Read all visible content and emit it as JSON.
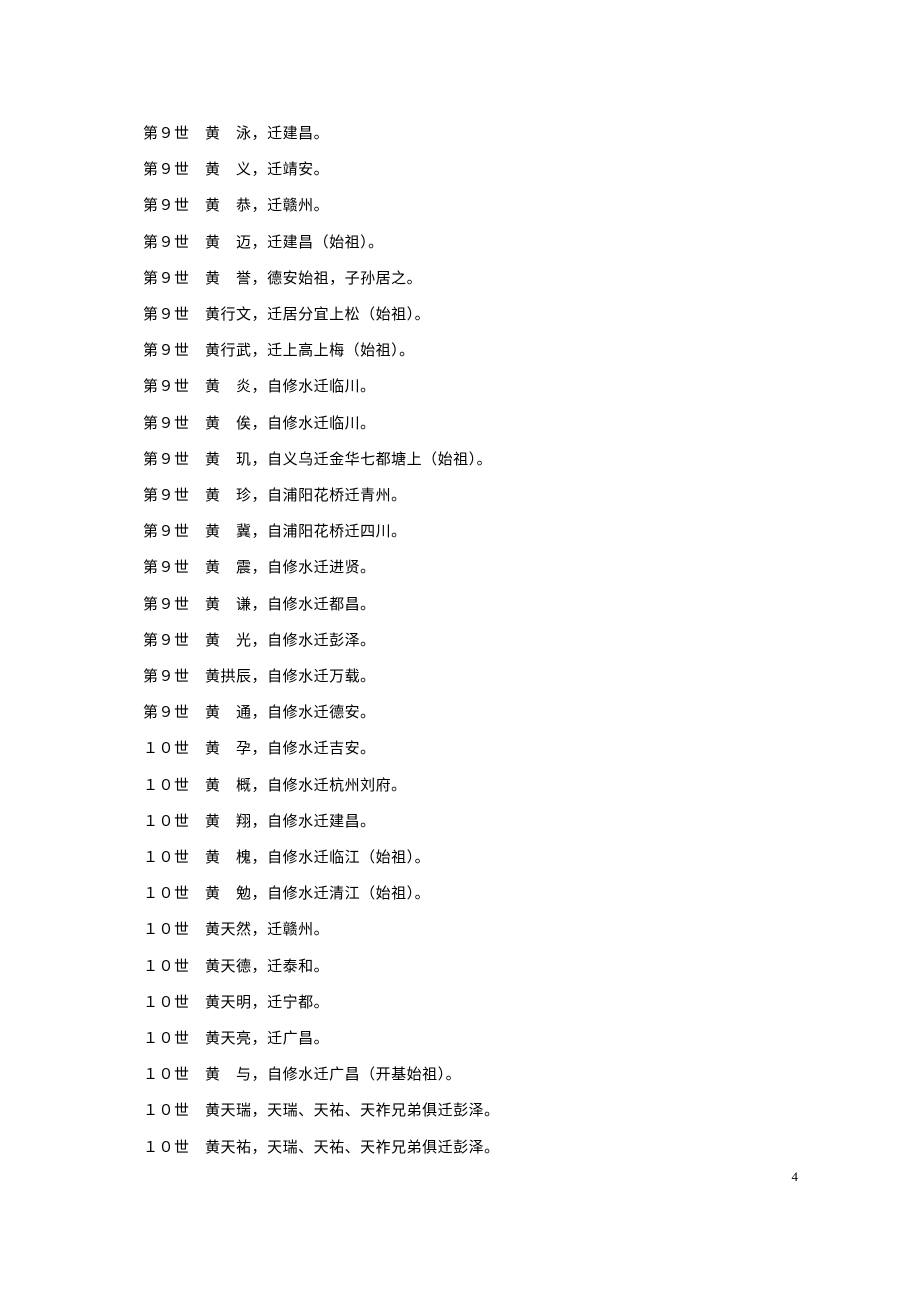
{
  "entries": [
    {
      "gen": "第９世",
      "name": "黄　泳",
      "desc": "迁建昌。"
    },
    {
      "gen": "第９世",
      "name": "黄　义",
      "desc": "迁靖安。"
    },
    {
      "gen": "第９世",
      "name": "黄　恭",
      "desc": "迁赣州。"
    },
    {
      "gen": "第９世",
      "name": "黄　迈",
      "desc": "迁建昌（始祖）。"
    },
    {
      "gen": "第９世",
      "name": "黄　誉",
      "desc": "德安始祖，子孙居之。"
    },
    {
      "gen": "第９世",
      "name": "黄行文",
      "desc": "迁居分宜上松（始祖）。"
    },
    {
      "gen": "第９世",
      "name": "黄行武",
      "desc": "迁上高上梅（始祖）。"
    },
    {
      "gen": "第９世",
      "name": "黄　炎",
      "desc": "自修水迁临川。"
    },
    {
      "gen": "第９世",
      "name": "黄　俟",
      "desc": "自修水迁临川。"
    },
    {
      "gen": "第９世",
      "name": "黄　玑",
      "desc": "自义乌迁金华七都塘上（始祖）。"
    },
    {
      "gen": "第９世",
      "name": "黄　珍",
      "desc": "自浦阳花桥迁青州。"
    },
    {
      "gen": "第９世",
      "name": "黄　冀",
      "desc": "自浦阳花桥迁四川。"
    },
    {
      "gen": "第９世",
      "name": "黄　震",
      "desc": "自修水迁进贤。"
    },
    {
      "gen": "第９世",
      "name": "黄　谦",
      "desc": "自修水迁都昌。"
    },
    {
      "gen": "第９世",
      "name": "黄　光",
      "desc": "自修水迁彭泽。"
    },
    {
      "gen": "第９世",
      "name": "黄拱辰",
      "desc": "自修水迁万载。"
    },
    {
      "gen": "第９世",
      "name": "黄　通",
      "desc": "自修水迁德安。"
    },
    {
      "gen": "１０世",
      "name": "黄　孕",
      "desc": "自修水迁吉安。"
    },
    {
      "gen": "１０世",
      "name": "黄　概",
      "desc": "自修水迁杭州刘府。"
    },
    {
      "gen": "１０世",
      "name": "黄　翔",
      "desc": "自修水迁建昌。"
    },
    {
      "gen": "１０世",
      "name": "黄　槐",
      "desc": "自修水迁临江（始祖）。"
    },
    {
      "gen": "１０世",
      "name": "黄　勉",
      "desc": "自修水迁清江（始祖）。"
    },
    {
      "gen": "１０世",
      "name": "黄天然",
      "desc": "迁赣州。"
    },
    {
      "gen": "１０世",
      "name": "黄天德",
      "desc": "迁泰和。"
    },
    {
      "gen": "１０世",
      "name": "黄天明",
      "desc": "迁宁都。"
    },
    {
      "gen": "１０世",
      "name": "黄天亮",
      "desc": "迁广昌。"
    },
    {
      "gen": "１０世",
      "name": "黄　与",
      "desc": "自修水迁广昌（开基始祖）。"
    },
    {
      "gen": "１０世",
      "name": "黄天瑞",
      "desc": "天瑞、天祐、天祚兄弟俱迁彭泽。"
    },
    {
      "gen": "１０世",
      "name": "黄天祐",
      "desc": "天瑞、天祐、天祚兄弟俱迁彭泽。"
    }
  ],
  "page_number": "4"
}
